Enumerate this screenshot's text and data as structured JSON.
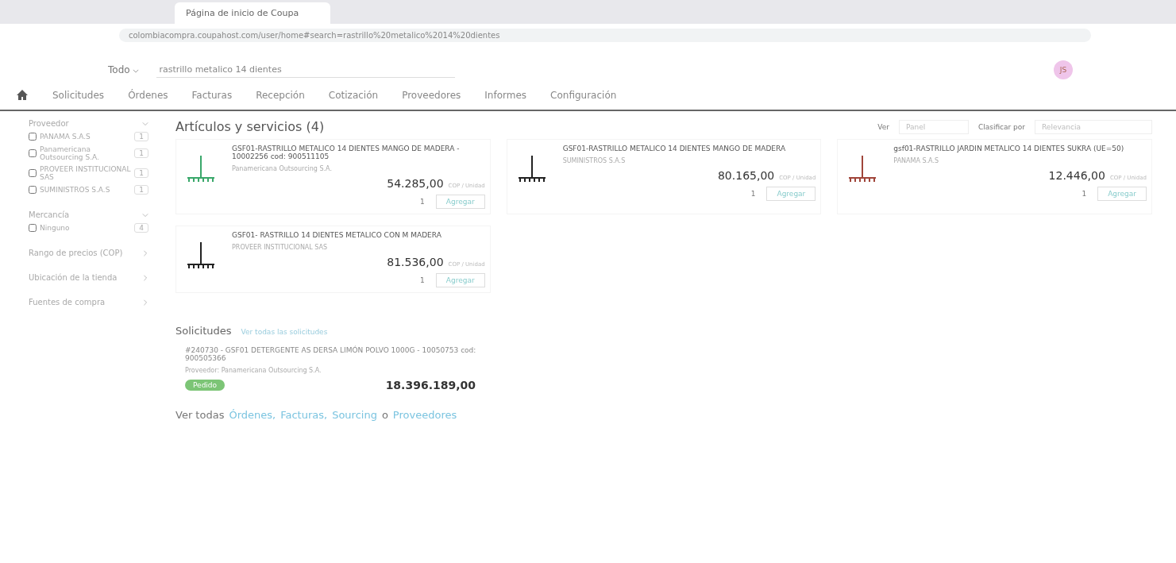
{
  "browser": {
    "tabs": [
      {
        "label": "Página de inicio de Coupa",
        "selected": true
      }
    ],
    "url": "colombiacompra.coupahost.com/user/home#search=rastrillo%20metalico%2014%20dientes"
  },
  "header": {
    "scope": "Todo",
    "search_value": "rastrillo metalico 14 dientes",
    "avatar": "JS"
  },
  "nav": [
    {
      "label": "Solicitudes",
      "selected": false
    },
    {
      "label": "Órdenes",
      "selected": false
    },
    {
      "label": "Facturas",
      "selected": false
    },
    {
      "label": "Recepción",
      "selected": false
    },
    {
      "label": "Cotización",
      "selected": false
    },
    {
      "label": "Proveedores",
      "selected": false
    },
    {
      "label": "Informes",
      "selected": false
    },
    {
      "label": "Configuración",
      "selected": false
    }
  ],
  "filters": [
    {
      "label": "Proveedor",
      "expanded": true,
      "options": [
        {
          "label": "PANAMA S.A.S",
          "count": "1",
          "checked": false
        },
        {
          "label": "Panamericana Outsourcing S.A.",
          "count": "1",
          "checked": false
        },
        {
          "label": "PROVEER INSTITUCIONAL SAS",
          "count": "1",
          "checked": false
        },
        {
          "label": "SUMINISTROS S.A.S",
          "count": "1",
          "checked": false
        }
      ]
    },
    {
      "label": "Mercancía",
      "expanded": true,
      "options": [
        {
          "label": "Ninguno",
          "count": "4",
          "checked": false
        }
      ]
    },
    {
      "label": "Rango de precios (COP)",
      "expanded": false
    },
    {
      "label": "Ubicación de la tienda",
      "expanded": false
    },
    {
      "label": "Fuentes de compra",
      "expanded": false
    }
  ],
  "results": {
    "title": "Artículos y servicios (4)",
    "view_label": "Ver",
    "view_value": "Panel",
    "sort_label": "Clasificar por",
    "sort_value": "Relevancia",
    "items": [
      {
        "title": "GSF01-RASTRILLO METALICO 14 DIENTES MANGO DE MADERA - 10002256 cod: 900511105",
        "supplier": "Panamericana Outsourcing S.A.",
        "price": "54.285,00",
        "unit": "COP / Unidad",
        "qty": "1",
        "action": "Agregar",
        "kind": "green"
      },
      {
        "title": "GSF01-RASTRILLO METALICO 14 DIENTES MANGO DE MADERA",
        "supplier": "SUMINISTROS S.A.S",
        "price": "80.165,00",
        "unit": "COP / Unidad",
        "qty": "1",
        "action": "Agregar",
        "kind": "black"
      },
      {
        "title": "gsf01-RASTRILLO JARDIN METALICO 14 DIENTES SUKRA (UE=50)",
        "supplier": "PANAMA S.A.S",
        "price": "12.446,00",
        "unit": "COP / Unidad",
        "qty": "1",
        "action": "Agregar",
        "kind": "red"
      },
      {
        "title": "GSF01- RASTRILLO 14 DIENTES METALICO CON M MADERA",
        "supplier": "PROVEER INSTITUCIONAL SAS",
        "price": "81.536,00",
        "unit": "COP / Unidad",
        "qty": "1",
        "action": "Agregar",
        "kind": "black"
      }
    ]
  },
  "requests": {
    "title": "Solicitudes",
    "link": "Ver todas las solicitudes",
    "items": [
      {
        "title": "#240730 - GSF01 DETERGENTE AS DERSA LIMÓN POLVO 1000G - 10050753 cod: 900505366",
        "supplier": "Proveedor: Panamericana Outsourcing S.A.",
        "status": "Pedido",
        "total": "18.396.189,00"
      }
    ]
  },
  "footer": {
    "prefix": "Ver todas",
    "links": [
      "Órdenes",
      "Facturas",
      "Sourcing",
      "Proveedores"
    ],
    "joiner": "o",
    "separator": ","
  }
}
